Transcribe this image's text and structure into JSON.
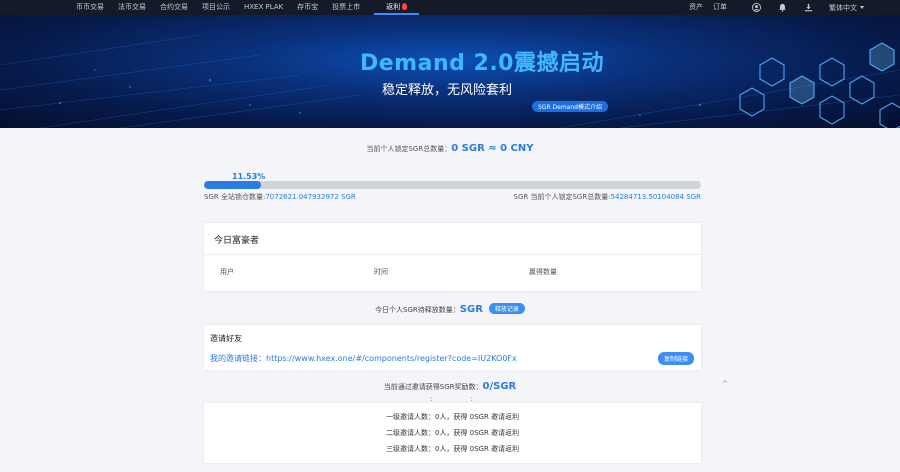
{
  "nav": {
    "left": [
      "币币交易",
      "法币交易",
      "合约交易",
      "项目公示",
      "HXEX PLAK",
      "存币宝",
      "投票上市"
    ],
    "active": "返利",
    "assets": "资产",
    "orders": "订单",
    "language": "繁体中文"
  },
  "banner": {
    "title": "Demand 2.0震撼启动",
    "subtitle": "稳定释放，无风险套利",
    "tag": "SGR Demand模式介绍"
  },
  "locked": {
    "label": "当前个人锁定SGR总数量：",
    "value": "0 SGR ≈ 0 CNY"
  },
  "progress": {
    "percent_label": "11.53%",
    "percent_value": 11.53,
    "left_label": "SGR 全站锁仓数量:",
    "left_value": "7072621.047932972 SGR",
    "right_label": "SGR 当前个人锁定SGR总数量:",
    "right_value": "54284713.50104084 SGR"
  },
  "rich_list": {
    "title": "今日富豪者",
    "columns": [
      "用户",
      "时间",
      "赢得数量"
    ]
  },
  "today_release": {
    "label": "今日个人SGR待释放数量：",
    "value": "SGR",
    "button": "释放记录"
  },
  "invite": {
    "title": "邀请好友",
    "link_label": "我的邀请链接：",
    "link": "https://www.hxex.one/#/components/register?code=IU2KO0Fx",
    "copy_button": "复制链接"
  },
  "reward": {
    "label": "当前通过邀请获得SGR奖励数：",
    "value": "0/SGR",
    "dots": ": :",
    "mark": "^"
  },
  "levels": [
    "一级邀请人数：0人，获得 0SGR 邀请返利",
    "二级邀请人数：0人，获得 0SGR 邀请返利",
    "三级邀请人数：0人，获得 0SGR 邀请返利"
  ],
  "colors": {
    "accent": "#2a7be4",
    "nav_bg": "#141a27",
    "banner_title": "#40b8ff"
  }
}
